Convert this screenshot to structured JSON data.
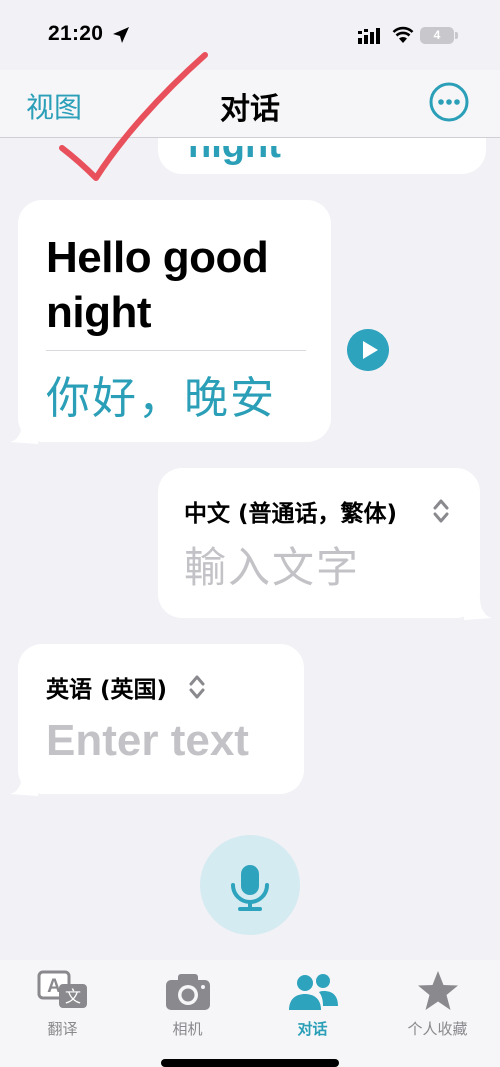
{
  "status": {
    "time": "21:20",
    "battery": "4"
  },
  "nav": {
    "left_label": "视图",
    "title": "对话",
    "more_icon": "ellipsis-circle-icon"
  },
  "conversation": {
    "previous": {
      "text": "night"
    },
    "entry": {
      "source_text": "Hello good night",
      "translation": "你好，晚安"
    },
    "chinese_input": {
      "language": "中文 (普通话，繁体)",
      "placeholder": "輸入文字"
    },
    "english_input": {
      "language": "英语 (英国)",
      "placeholder": "Enter text"
    }
  },
  "tabs": [
    {
      "label": "翻译",
      "icon": "translate-icon",
      "active": false
    },
    {
      "label": "相机",
      "icon": "camera-icon",
      "active": false
    },
    {
      "label": "对话",
      "icon": "people-icon",
      "active": true
    },
    {
      "label": "个人收藏",
      "icon": "star-icon",
      "active": false
    }
  ],
  "colors": {
    "accent": "#2a9fb7",
    "background": "#f2f1f6",
    "annotation": "#e8505b"
  }
}
